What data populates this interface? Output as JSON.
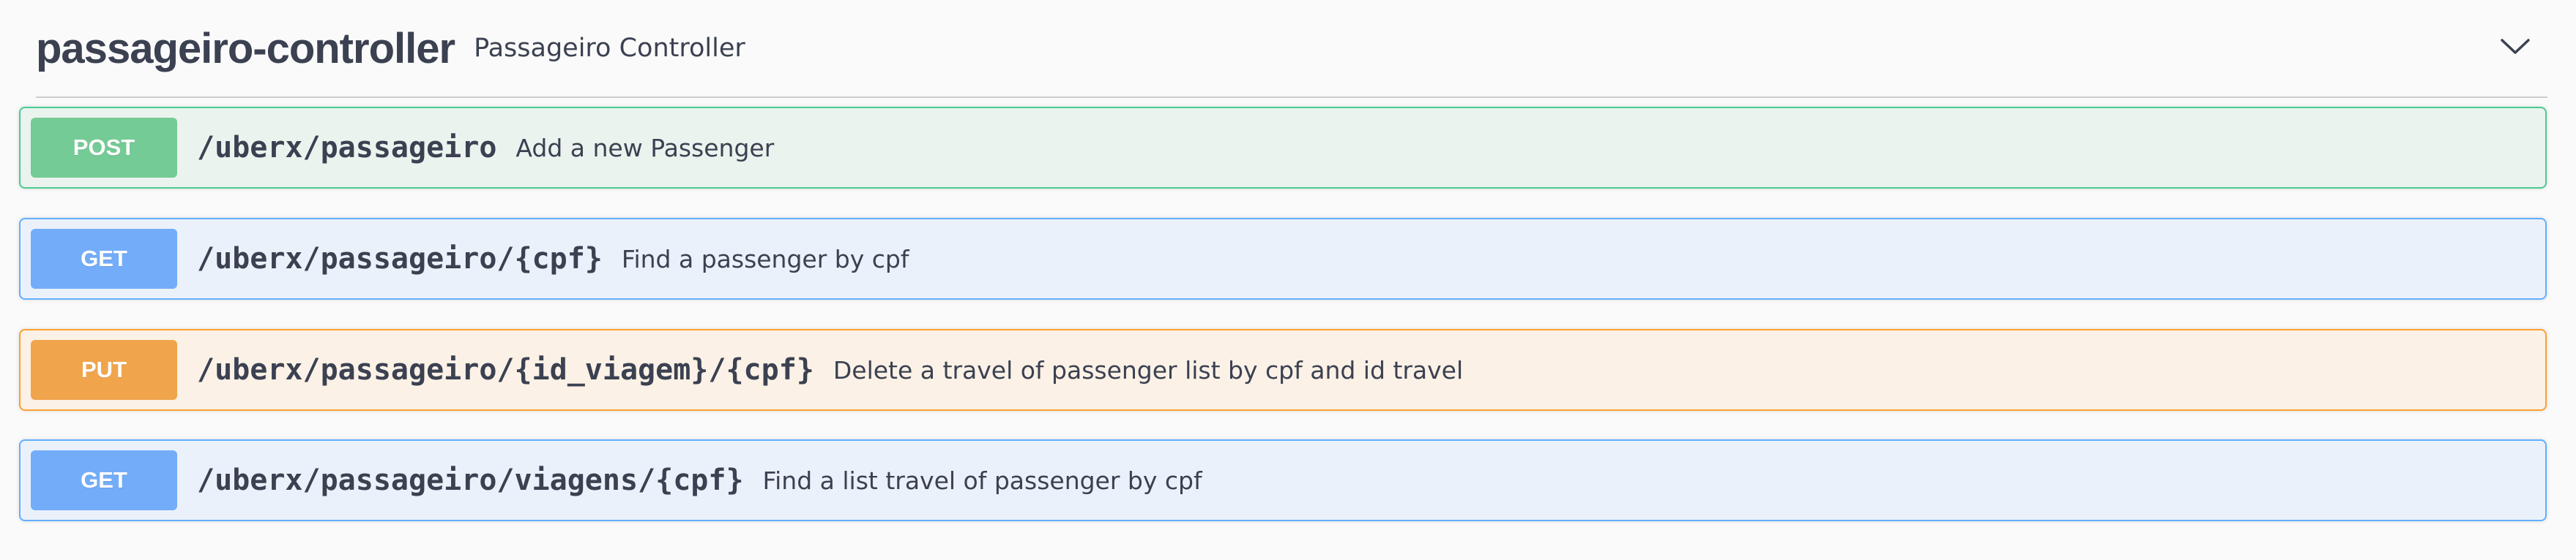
{
  "tag": {
    "name": "passageiro-controller",
    "description": "Passageiro Controller",
    "toggle_icon": "chevron-down-icon"
  },
  "operations": [
    {
      "method": "POST",
      "path": "/uberx/passageiro",
      "summary": "Add a new Passenger",
      "color": "#49cc90"
    },
    {
      "method": "GET",
      "path": "/uberx/passageiro/{cpf}",
      "summary": "Find a passenger by cpf",
      "color": "#61affe"
    },
    {
      "method": "PUT",
      "path": "/uberx/passageiro/{id_viagem}/{cpf}",
      "summary": "Delete a travel of passenger list by cpf and id travel",
      "color": "#fca130"
    },
    {
      "method": "GET",
      "path": "/uberx/passageiro/viagens/{cpf}",
      "summary": "Find a list travel of passenger by cpf",
      "color": "#61affe"
    }
  ]
}
